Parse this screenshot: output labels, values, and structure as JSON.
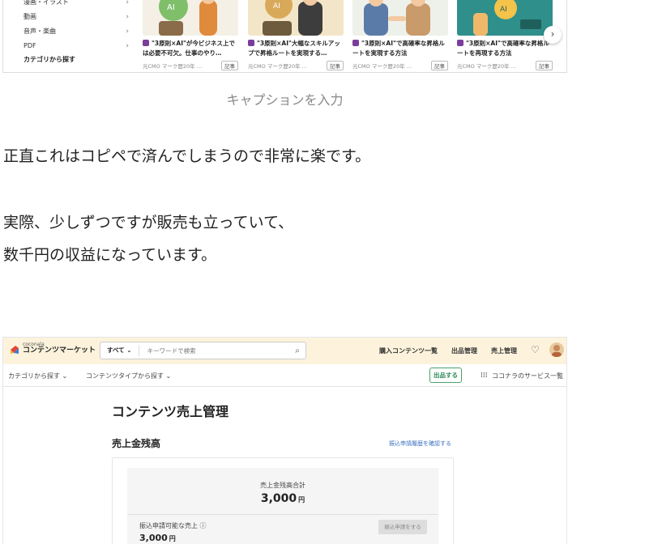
{
  "article_top": {
    "categories": [
      {
        "label": "漫画・イラスト"
      },
      {
        "label": "動画"
      },
      {
        "label": "音声・楽曲"
      },
      {
        "label": "PDF"
      }
    ],
    "category_search_label": "カテゴリから探す",
    "cards": [
      {
        "title": "\"3原則×AI\"が今ビジネス上では必要不可欠。仕事のやり…",
        "author": "元CMO マーク歴20年 …",
        "badge": "記事",
        "thumb_bg": "#f4f0e6"
      },
      {
        "title": "\"3原則×AI\"大幅なスキルアップで昇格ルートを実現する…",
        "author": "元CMO マーク歴20年 …",
        "badge": "記事",
        "thumb_bg": "#f3e6c8"
      },
      {
        "title": "\"3原則×AI\"で高確率な昇格ルートを実現する方法",
        "author": "元CMO マーク歴20年 …",
        "badge": "記事",
        "thumb_bg": "#eef0ea"
      },
      {
        "title": "\"3原則×AI\"で高確率な昇格ルートを再現する方法",
        "author": "元CMO マーク歴20年 …",
        "badge": "記事",
        "thumb_bg": "#2f8f8b"
      }
    ],
    "next_arrow": "›"
  },
  "caption": "キャプションを入力",
  "paragraphs": [
    "正直これはコピペで済んでしまうので非常に楽です。",
    "実際、少しずつですが販売も立っていて、",
    "数千円の収益になっています。"
  ],
  "screenshot": {
    "logo_small": "coconala",
    "logo_big": "コンテンツマーケット",
    "search_scope": "すべて ⌄",
    "search_placeholder": "キーワードで検索",
    "nav": [
      "購入コンテンツ一覧",
      "出品管理",
      "売上管理"
    ],
    "sub_nav": [
      "カテゴリから探す ⌄",
      "コンテンツタイプから探す ⌄"
    ],
    "sell_button": "出品する",
    "services_link": "ココナラのサービス一覧",
    "page_title": "コンテンツ売上管理",
    "section_title": "売上金残高",
    "history_link": "振込申請履歴を確認する",
    "total_label": "売上金残高合計",
    "total_value": "3,000",
    "unit": "円",
    "available_label": "振込申請可能な売上 ⓘ",
    "available_value": "3,000",
    "request_button": "振込申請をする"
  },
  "colors": {
    "header_bg": "#fdf3dc",
    "accent_green": "#2e8b57",
    "link_blue": "#3a6fbf"
  }
}
